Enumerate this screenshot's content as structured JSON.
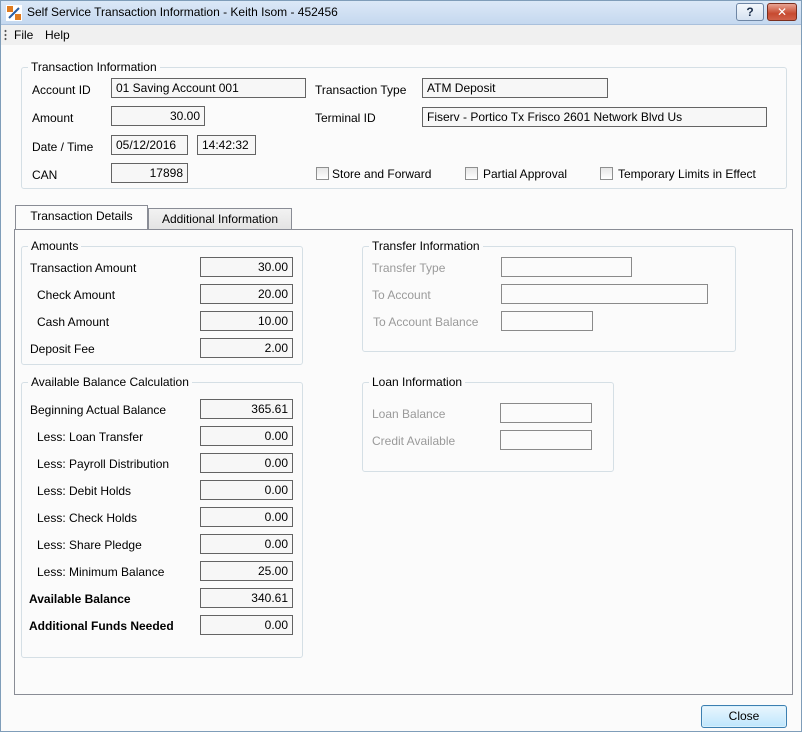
{
  "window": {
    "title": "Self Service Transaction Information - Keith Isom - 452456",
    "help_button": "?",
    "close_button": "✕"
  },
  "menu": {
    "items": [
      "File",
      "Help"
    ]
  },
  "transaction_info": {
    "title": "Transaction Information",
    "account_id_label": "Account ID",
    "account_id": "01 Saving Account 001",
    "transaction_type_label": "Transaction Type",
    "transaction_type": "ATM Deposit",
    "amount_label": "Amount",
    "amount": "30.00",
    "terminal_id_label": "Terminal ID",
    "terminal_id": "Fiserv - Portico  Tx Frisco 2601 Network Blvd Us",
    "datetime_label": "Date / Time",
    "date": "05/12/2016",
    "time": "14:42:32",
    "can_label": "CAN",
    "can": "17898",
    "store_forward_label": "Store and Forward",
    "partial_approval_label": "Partial Approval",
    "temp_limits_label": "Temporary Limits in Effect"
  },
  "tabs": {
    "details": "Transaction Details",
    "additional": "Additional Information"
  },
  "amounts": {
    "title": "Amounts",
    "rows": [
      {
        "label": "Transaction Amount",
        "value": "30.00"
      },
      {
        "label": "Check Amount",
        "value": "20.00"
      },
      {
        "label": "Cash Amount",
        "value": "10.00"
      },
      {
        "label": "Deposit Fee",
        "value": "2.00"
      }
    ]
  },
  "available_balance": {
    "title": "Available Balance Calculation",
    "rows": [
      {
        "label": "Beginning Actual Balance",
        "value": "365.61"
      },
      {
        "label": "Less: Loan Transfer",
        "value": "0.00"
      },
      {
        "label": "Less: Payroll Distribution",
        "value": "0.00"
      },
      {
        "label": "Less: Debit Holds",
        "value": "0.00"
      },
      {
        "label": "Less: Check Holds",
        "value": "0.00"
      },
      {
        "label": "Less: Share Pledge",
        "value": "0.00"
      },
      {
        "label": "Less: Minimum Balance",
        "value": "25.00"
      },
      {
        "label": "Available Balance",
        "value": "340.61"
      },
      {
        "label": "Additional Funds Needed",
        "value": "0.00"
      }
    ]
  },
  "transfer_info": {
    "title": "Transfer Information",
    "transfer_type_label": "Transfer Type",
    "to_account_label": "To Account",
    "to_account_balance_label": "To Account Balance"
  },
  "loan_info": {
    "title": "Loan Information",
    "loan_balance_label": "Loan Balance",
    "credit_available_label": "Credit Available"
  },
  "footer": {
    "close_label": "Close"
  }
}
